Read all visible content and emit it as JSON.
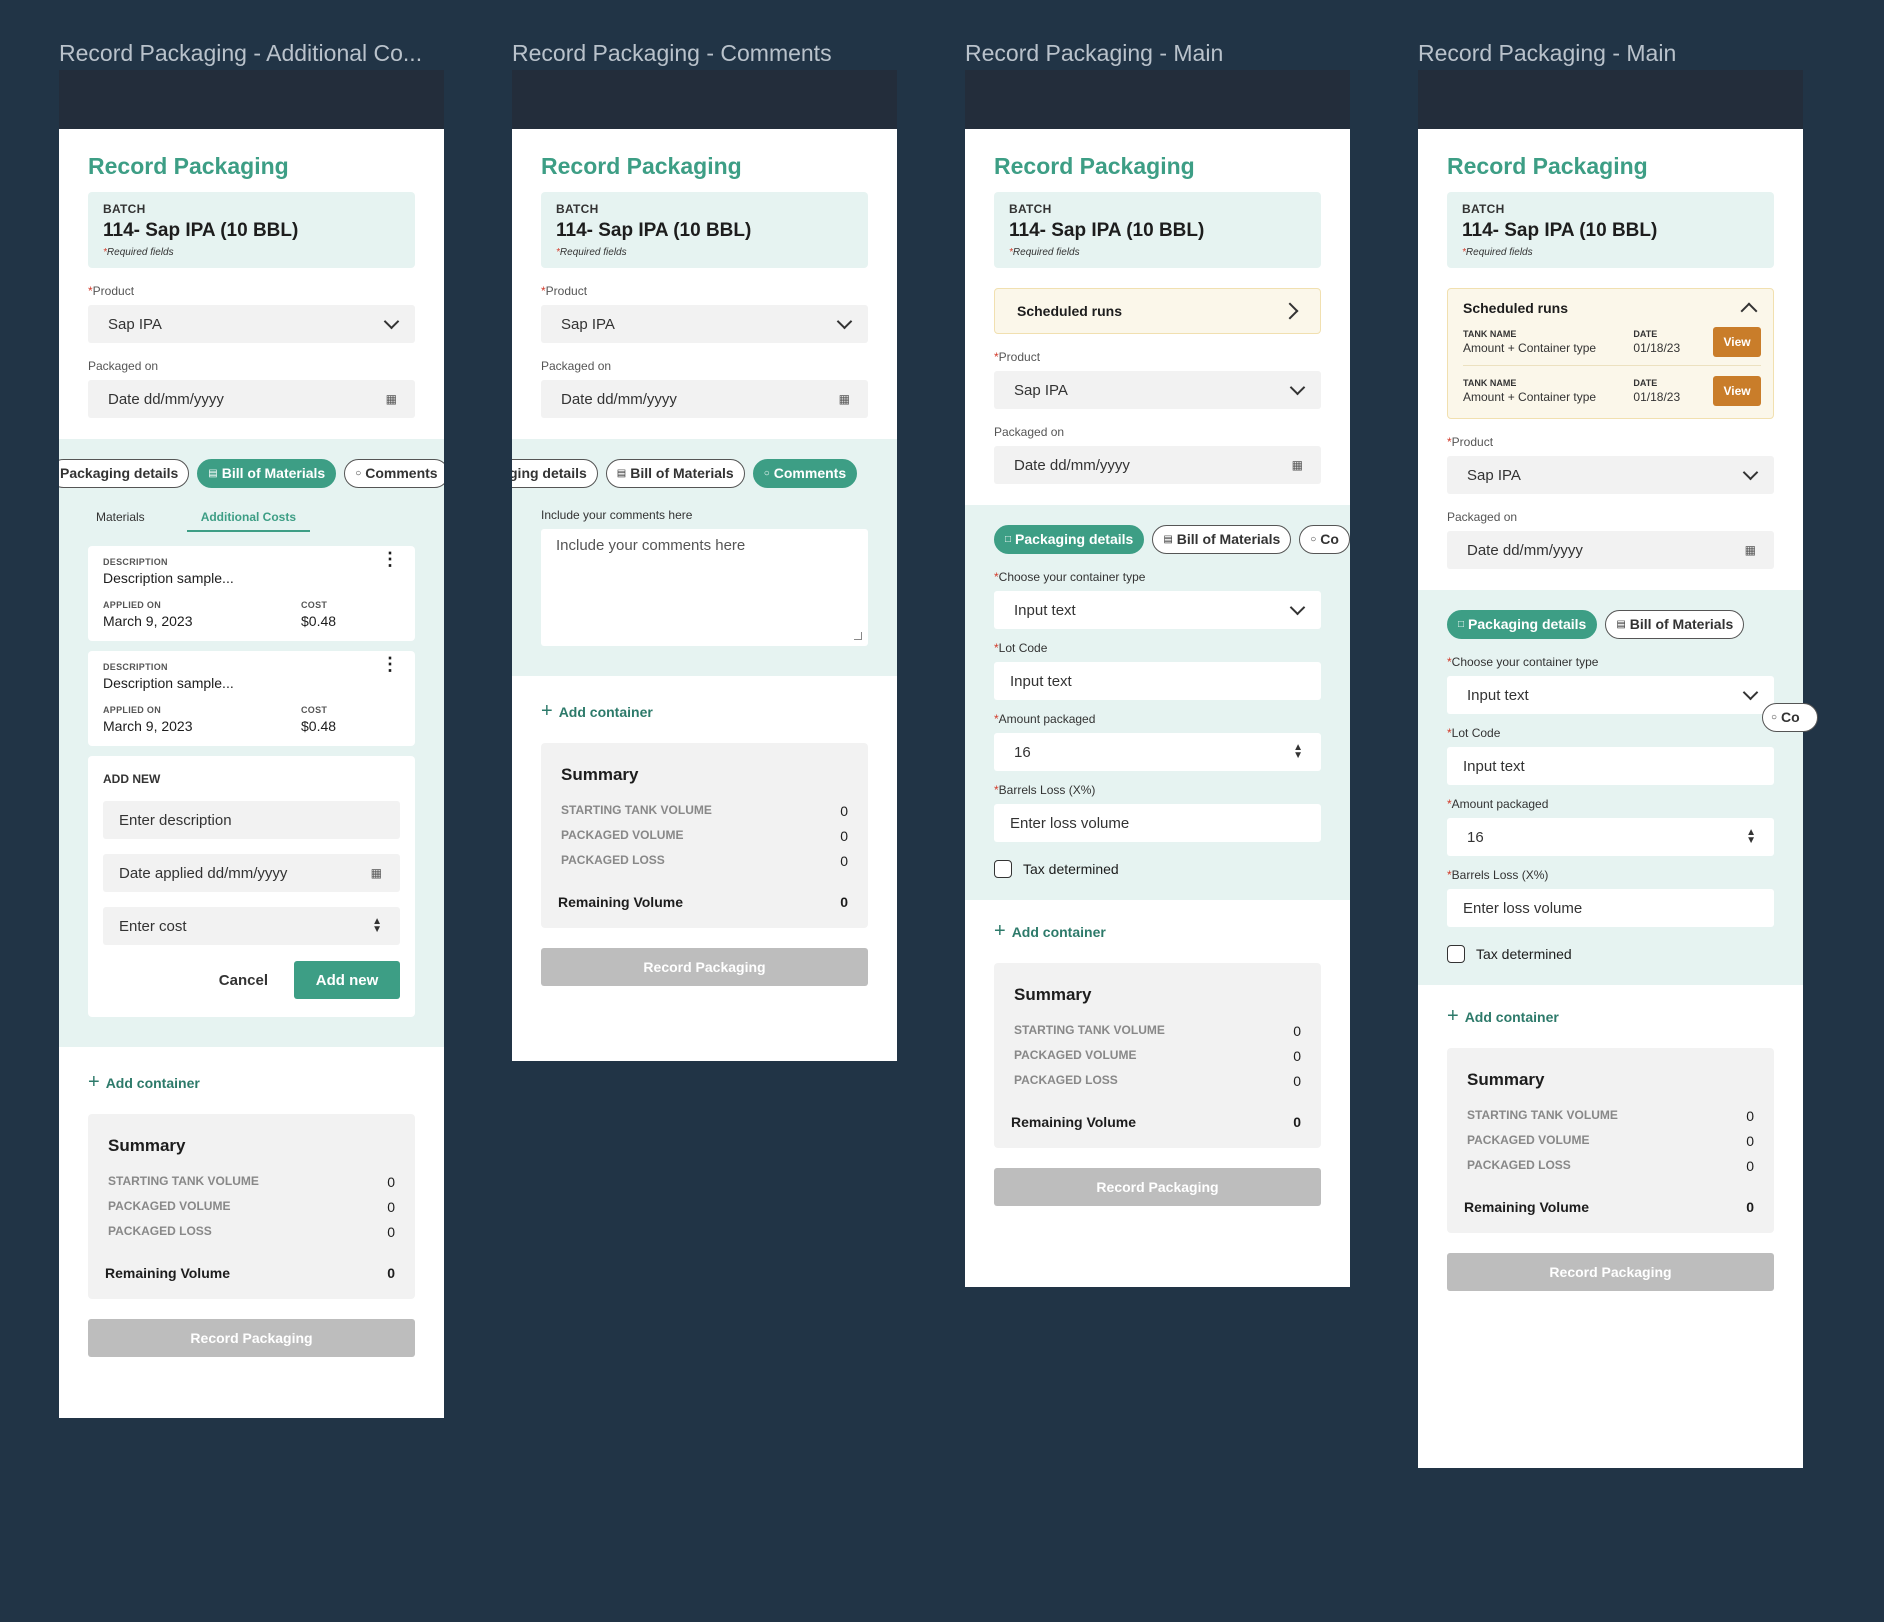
{
  "frames": [
    {
      "title": "Record Packaging - Additional Co..."
    },
    {
      "title": "Record Packaging - Comments"
    },
    {
      "title": "Record Packaging - Main"
    },
    {
      "title": "Record Packaging - Main"
    }
  ],
  "common": {
    "page_title": "Record Packaging",
    "batch_label": "BATCH",
    "batch_value": "114- Sap IPA (10 BBL)",
    "required_star": "*",
    "required_text": "Required fields",
    "product_label": "Product",
    "product_value": "Sap IPA",
    "packaged_on_label": "Packaged on",
    "packaged_on_placeholder": "Date dd/mm/yyyy",
    "calendar_icon": "calendar-icon",
    "tabs": {
      "packaging_details": "Packaging details",
      "packaging_details_cut1": "Packaging details",
      "packaging_details_cut2": "ging details",
      "bill_of_materials": "Bill of Materials",
      "comments": "Comments",
      "comments_cut": "Co"
    },
    "add_container": "Add container",
    "summary": {
      "title": "Summary",
      "starting_tank_volume_label": "STARTING TANK VOLUME",
      "starting_tank_volume": "0",
      "packaged_volume_label": "PACKAGED VOLUME",
      "packaged_volume": "0",
      "packaged_loss_label": "PACKAGED LOSS",
      "packaged_loss": "0",
      "remaining_volume_label": "Remaining Volume",
      "remaining_volume": "0"
    },
    "record_button": "Record Packaging"
  },
  "additional_costs": {
    "subtabs": [
      "Materials",
      "Additional Costs"
    ],
    "items": [
      {
        "description_label": "DESCRIPTION",
        "description": "Description sample...",
        "applied_on_label": "APPLIED ON",
        "applied_on": "March 9, 2023",
        "cost_label": "COST",
        "cost": "$0.48"
      },
      {
        "description_label": "DESCRIPTION",
        "description": "Description sample...",
        "applied_on_label": "APPLIED ON",
        "applied_on": "March 9, 2023",
        "cost_label": "COST",
        "cost": "$0.48"
      }
    ],
    "add_new_title": "ADD NEW",
    "description_placeholder": "Enter description",
    "date_placeholder": "Date applied dd/mm/yyyy",
    "cost_placeholder": "Enter cost",
    "cancel": "Cancel",
    "add_new": "Add new"
  },
  "comments": {
    "label": "Include your comments here",
    "placeholder": "Include your comments here"
  },
  "main": {
    "scheduled_runs": "Scheduled runs",
    "container_type_label": "Choose your container type",
    "container_type_value": "Input text",
    "lot_code_label": "Lot Code",
    "lot_code_value": "Input text",
    "amount_label": "Amount packaged",
    "amount_value": "16",
    "barrels_loss_label": "Barrels Loss (X%)",
    "barrels_loss_placeholder": "Enter loss volume",
    "tax_determined": "Tax determined",
    "runs": [
      {
        "tank_label": "TANK NAME",
        "tank_value": "Amount + Container type",
        "date_label": "DATE",
        "date_value": "01/18/23",
        "view": "View"
      },
      {
        "tank_label": "TANK NAME",
        "tank_value": "Amount + Container type",
        "date_label": "DATE",
        "date_value": "01/18/23",
        "view": "View"
      }
    ]
  }
}
